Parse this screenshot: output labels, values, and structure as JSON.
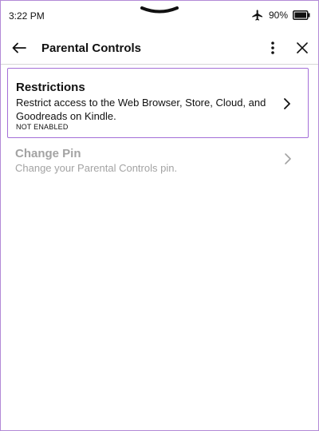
{
  "status_bar": {
    "time": "3:22 PM",
    "battery": "90%",
    "icons": [
      "pull-handle-icon",
      "airplane-icon",
      "battery-icon"
    ]
  },
  "header": {
    "title": "Parental Controls",
    "icons": [
      "back-arrow-icon",
      "more-vertical-icon",
      "close-icon"
    ]
  },
  "items": [
    {
      "title": "Restrictions",
      "description": "Restrict access to the Web Browser, Store, Cloud, and Goodreads on Kindle.",
      "status": "NOT ENABLED",
      "enabled": true
    },
    {
      "title": "Change Pin",
      "description": "Change your Parental Controls pin.",
      "enabled": false
    }
  ],
  "colors": {
    "highlight_border": "#a46fd8",
    "disabled_text": "#a3a3a3",
    "divider": "#d7d7d7"
  }
}
